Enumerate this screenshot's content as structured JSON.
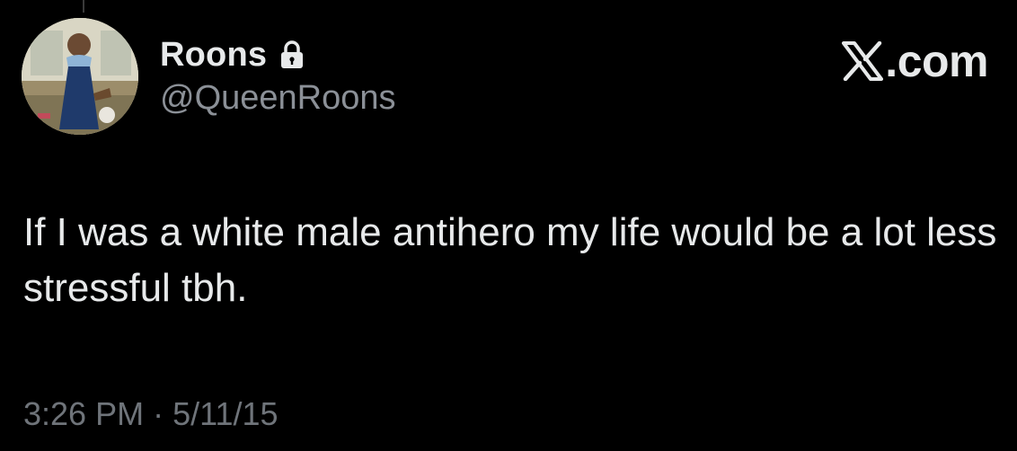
{
  "user": {
    "display_name": "Roons",
    "handle": "@QueenRoons",
    "verified_lock_icon": "lock-icon",
    "avatar": "avatar-image"
  },
  "brand": {
    "logo_icon": "x-logo-icon",
    "suffix": ".com"
  },
  "tweet": {
    "text": "If I was a white male antihero my life would be a lot less stressful tbh."
  },
  "meta": {
    "time": "3:26 PM",
    "separator": "·",
    "date": "5/11/15"
  },
  "colors": {
    "background": "#000000",
    "text": "#e7e9ea",
    "handle": "#8b9097",
    "meta": "#6f747a"
  }
}
